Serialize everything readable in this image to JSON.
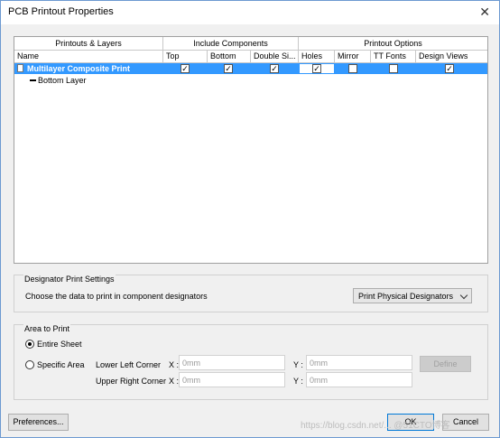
{
  "window": {
    "title": "PCB Printout Properties",
    "close_glyph": "✕"
  },
  "grid": {
    "group_headers": [
      "Printouts & Layers",
      "Include Components",
      "Printout Options"
    ],
    "columns": [
      "Name",
      "Top",
      "Bottom",
      "Double Si...",
      "Holes",
      "Mirror",
      "TT Fonts",
      "Design Views"
    ],
    "rows": [
      {
        "name": "Multilayer Composite Print",
        "top": true,
        "bottom": true,
        "double_sided": true,
        "holes": true,
        "mirror": false,
        "tt_fonts": false,
        "design_views": true,
        "selected": true
      },
      {
        "name": "Bottom Layer"
      }
    ],
    "check_glyph": "✓"
  },
  "designator": {
    "legend": "Designator Print Settings",
    "prompt": "Choose the data to print in component designators",
    "selected": "Print Physical Designators"
  },
  "area": {
    "legend": "Area to Print",
    "entire_sheet": "Entire Sheet",
    "specific_area": "Specific Area",
    "selected": "Entire Sheet",
    "lower_left": "Lower Left Corner",
    "upper_right": "Upper Right Corner",
    "x_label": "X :",
    "y_label": "Y :",
    "ll_x": "0mm",
    "ll_y": "0mm",
    "ur_x": "0mm",
    "ur_y": "0mm",
    "define": "Define"
  },
  "buttons": {
    "preferences": "Preferences...",
    "ok": "OK",
    "cancel": "Cancel"
  },
  "watermark": "https://blog.csdn.net/... @51CTO博客"
}
